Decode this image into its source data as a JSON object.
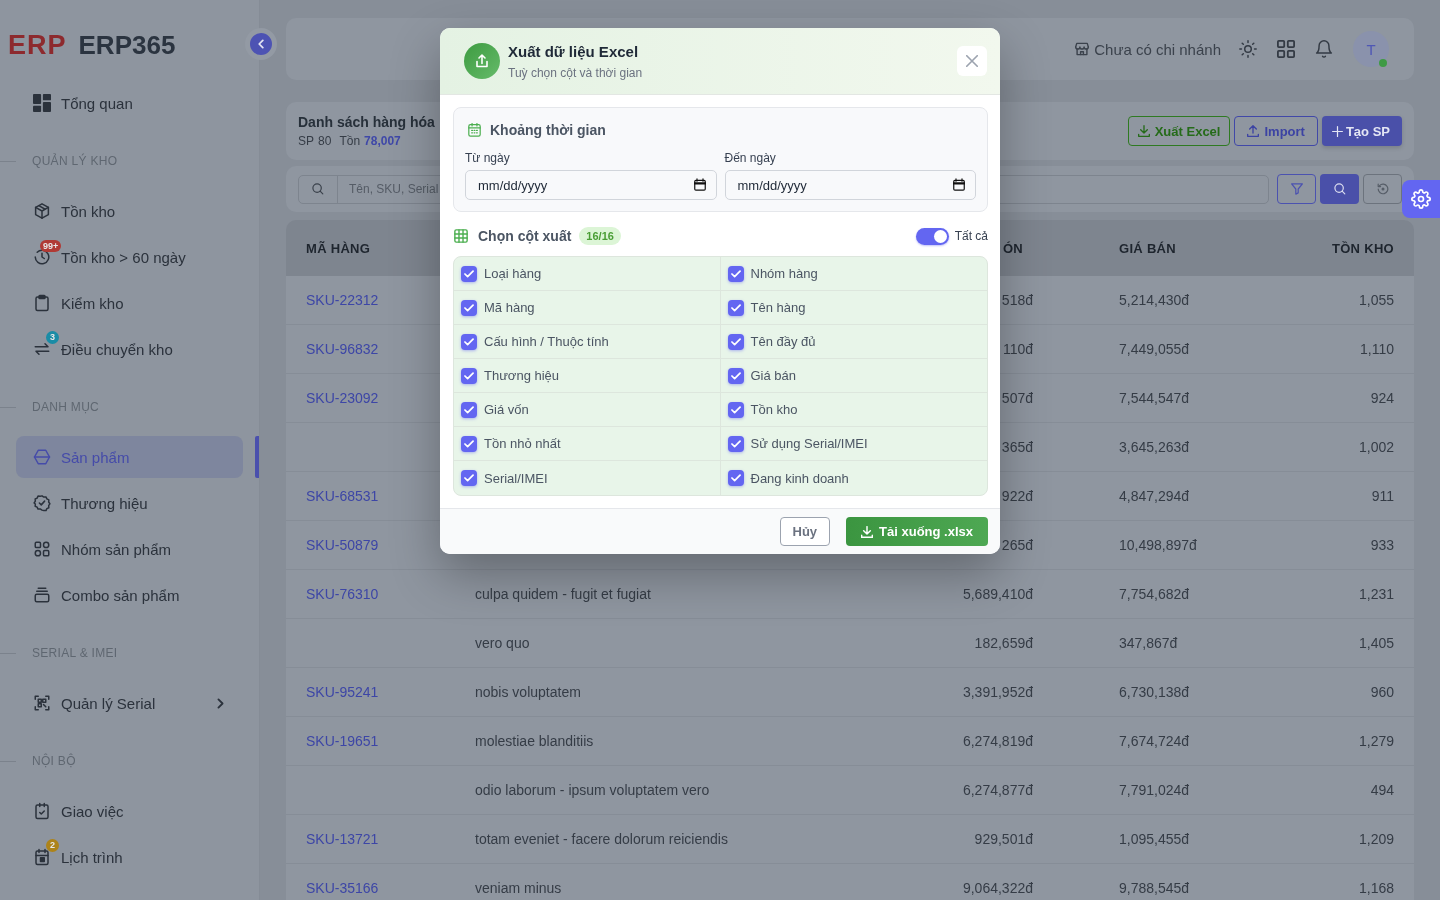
{
  "sidebar": {
    "logo": {
      "mark": "ERP",
      "name": "ERP365"
    },
    "sections": [
      {
        "items": [
          {
            "label": "Tổng quan",
            "selected": false
          }
        ]
      },
      {
        "title": "QUẢN LÝ KHO",
        "items": [
          {
            "label": "Tồn kho",
            "selected": false
          },
          {
            "label": "Tồn kho > 60 ngày",
            "selected": false,
            "badge": {
              "text": "99+",
              "color": "#b03a35"
            }
          },
          {
            "label": "Kiểm kho",
            "selected": false
          },
          {
            "label": "Điều chuyển kho",
            "selected": false,
            "badge": {
              "text": "3",
              "color": "#1a8ca6"
            }
          }
        ]
      },
      {
        "title": "DANH MỤC",
        "items": [
          {
            "label": "Sản phẩm",
            "selected": true
          },
          {
            "label": "Thương hiệu",
            "selected": false
          },
          {
            "label": "Nhóm sản phẩm",
            "selected": false
          },
          {
            "label": "Combo sản phẩm",
            "selected": false
          }
        ]
      },
      {
        "title": "SERIAL & IMEI",
        "items": [
          {
            "label": "Quản lý Serial",
            "selected": false,
            "expanded": false
          }
        ]
      },
      {
        "title": "NỘI BỘ",
        "items": [
          {
            "label": "Giao việc",
            "selected": false
          },
          {
            "label": "Lịch trình",
            "selected": false,
            "badge": {
              "text": "2",
              "color": "#ad8319"
            }
          }
        ]
      }
    ]
  },
  "topbar": {
    "branch": "Chưa có chi nhánh",
    "avatar": {
      "initial": "T",
      "online": true
    }
  },
  "page_header": {
    "title": "Danh sách hàng hóa",
    "stats": [
      {
        "label": "SP",
        "value": "80",
        "kind": "plain"
      },
      {
        "label": "Tồn",
        "value": "78,007",
        "kind": "highlight"
      }
    ],
    "actions": [
      {
        "label": "Xuất Excel",
        "kind": "export"
      },
      {
        "label": "Import",
        "kind": "import"
      },
      {
        "label": "Tạo SP",
        "kind": "create"
      }
    ]
  },
  "search": {
    "placeholder": "Tên, SKU, Serial"
  },
  "table": {
    "columns": {
      "ma_hang": "MÃ HÀNG",
      "column_3": "ÓN",
      "gia_ban": "GIÁ BÁN",
      "ton_kho": "TỒN KHO"
    },
    "rows": [
      {
        "ma_hang": "SKU-22312",
        "column_3": "518đ",
        "gia_ban": "5,214,430đ",
        "ton_kho": "1,055"
      },
      {
        "ma_hang": "SKU-96832",
        "column_3": "110đ",
        "gia_ban": "7,449,055đ",
        "ton_kho": "1,110"
      },
      {
        "ma_hang": "SKU-23092",
        "column_3": "507đ",
        "gia_ban": "7,544,547đ",
        "ton_kho": "924"
      },
      {
        "column_3": "365đ",
        "gia_ban": "3,645,263đ",
        "ton_kho": "1,002"
      },
      {
        "ma_hang": "SKU-68531",
        "column_3": "922đ",
        "gia_ban": "4,847,294đ",
        "ton_kho": "911"
      },
      {
        "ma_hang": "SKU-50879",
        "column_3": "265đ",
        "gia_ban": "10,498,897đ",
        "ton_kho": "933"
      },
      {
        "ma_hang": "SKU-76310",
        "column_2": "culpa quidem - fugit et fugiat",
        "column_3": "5,689,410đ",
        "gia_ban": "7,754,682đ",
        "ton_kho": "1,231"
      },
      {
        "column_2": "vero quo",
        "column_3": "182,659đ",
        "gia_ban": "347,867đ",
        "ton_kho": "1,405"
      },
      {
        "ma_hang": "SKU-95241",
        "column_2": "nobis voluptatem",
        "column_3": "3,391,952đ",
        "gia_ban": "6,730,138đ",
        "ton_kho": "960"
      },
      {
        "ma_hang": "SKU-19651",
        "column_2": "molestiae blanditiis",
        "column_3": "6,274,819đ",
        "gia_ban": "7,674,724đ",
        "ton_kho": "1,279"
      },
      {
        "column_2": "odio laborum - ipsum voluptatem vero",
        "column_3": "6,274,877đ",
        "gia_ban": "7,791,024đ",
        "ton_kho": "494"
      },
      {
        "ma_hang": "SKU-13721",
        "column_2": "totam eveniet - facere dolorum reiciendis",
        "column_3": "929,501đ",
        "gia_ban": "1,095,455đ",
        "ton_kho": "1,209"
      },
      {
        "ma_hang": "SKU-35166",
        "column_2": "veniam minus",
        "column_3": "9,064,322đ",
        "gia_ban": "9,788,545đ",
        "ton_kho": "1,168"
      }
    ]
  },
  "export_modal": {
    "title": "Xuất dữ liệu Excel",
    "subtitle": "Tuỳ chọn cột và thời gian",
    "date_range": {
      "title": "Khoảng thời gian",
      "from": {
        "label": "Từ ngày",
        "placeholder": "mm/dd/yyyy"
      },
      "to": {
        "label": "Đến ngày",
        "placeholder": "mm/dd/yyyy"
      }
    },
    "columns": {
      "title": "Chọn cột xuất",
      "count": "16/16",
      "select_all": {
        "label": "Tất cả",
        "on": true
      },
      "items": [
        {
          "label": "Loại hàng",
          "checked": true
        },
        {
          "label": "Nhóm hàng",
          "checked": true
        },
        {
          "label": "Mã hàng",
          "checked": true
        },
        {
          "label": "Tên hàng",
          "checked": true
        },
        {
          "label": "Cấu hình / Thuộc tính",
          "checked": true
        },
        {
          "label": "Tên đầy đủ",
          "checked": true
        },
        {
          "label": "Thương hiệu",
          "checked": true
        },
        {
          "label": "Giá bán",
          "checked": true
        },
        {
          "label": "Giá vốn",
          "checked": true
        },
        {
          "label": "Tồn kho",
          "checked": true
        },
        {
          "label": "Tồn nhỏ nhất",
          "checked": true
        },
        {
          "label": "Sử dụng Serial/IMEI",
          "checked": true
        },
        {
          "label": "Serial/IMEI",
          "checked": true
        },
        {
          "label": "Đang kinh doanh",
          "checked": true
        }
      ]
    },
    "buttons": [
      {
        "label": "Hủy",
        "kind": "cancel"
      },
      {
        "label": "Tải xuống .xlsx",
        "kind": "download"
      }
    ]
  }
}
